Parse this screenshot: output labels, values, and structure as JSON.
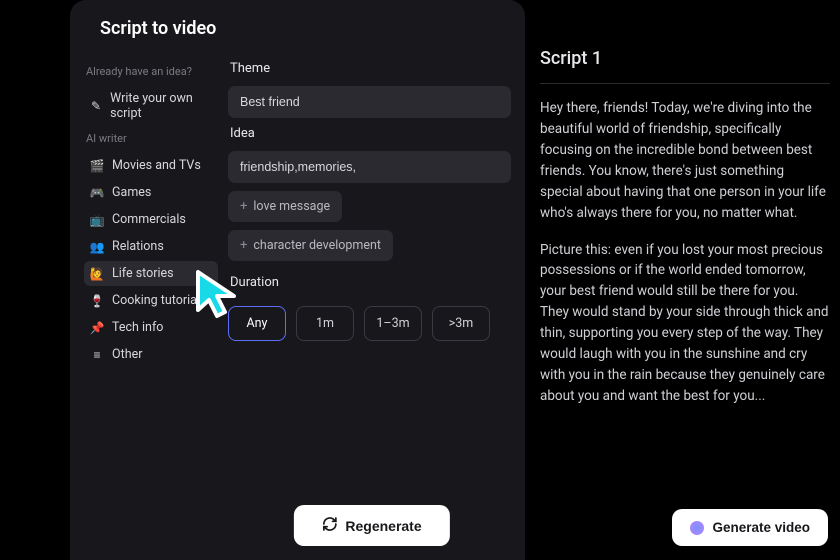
{
  "title": "Script to video",
  "sidebar": {
    "section1": "Already have an idea?",
    "write_own": "Write your own script",
    "section2": "AI writer",
    "items": [
      {
        "icon": "🎬",
        "label": "Movies and TVs"
      },
      {
        "icon": "🎮",
        "label": "Games"
      },
      {
        "icon": "📺",
        "label": "Commercials"
      },
      {
        "icon": "👥",
        "label": "Relations"
      },
      {
        "icon": "🙋",
        "label": "Life stories"
      },
      {
        "icon": "🍷",
        "label": "Cooking tutorials"
      },
      {
        "icon": "📌",
        "label": "Tech info"
      },
      {
        "icon": "≡",
        "label": "Other"
      }
    ],
    "active_index": 4
  },
  "form": {
    "theme_label": "Theme",
    "theme_value": "Best friend",
    "idea_label": "Idea",
    "idea_value": "friendship,memories,",
    "idea_chips": [
      "love message",
      "character development"
    ],
    "duration_label": "Duration",
    "duration_options": [
      "Any",
      "1m",
      "1–3m",
      ">3m"
    ],
    "duration_active": 0,
    "regenerate": "Regenerate"
  },
  "script": {
    "title": "Script 1",
    "paragraphs": [
      "Hey there, friends! Today, we're diving into the beautiful world of friendship, specifically focusing on the incredible bond between best friends. You know, there's just something special about having that one person in your life who's always there for you, no matter what.",
      "Picture this: even if you lost your most precious possessions or if the world ended tomorrow, your best friend would still be there for you. They would stand by your side through thick and thin, supporting you every step of the way. They would laugh with you in the sunshine and cry with you in the rain because they genuinely care about you and want the best for you..."
    ]
  },
  "generate": "Generate video"
}
